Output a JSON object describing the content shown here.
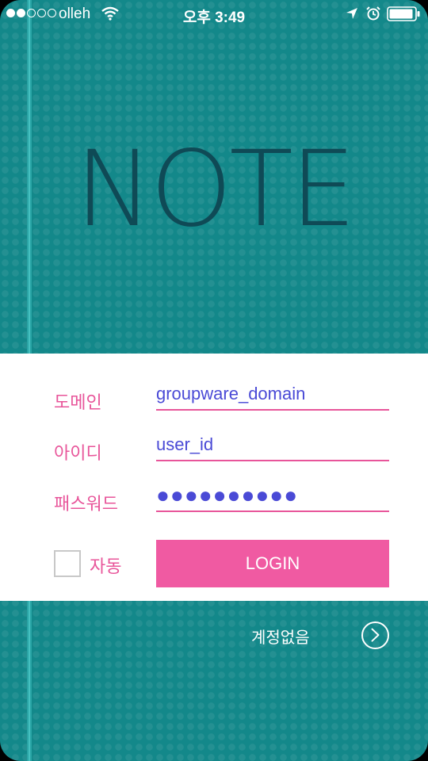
{
  "status_bar": {
    "carrier": "olleh",
    "time": "오후 3:49",
    "signal_bars_filled": 2,
    "signal_bars_total": 5
  },
  "app": {
    "title": "NOTE"
  },
  "login_form": {
    "domain_label": "도메인",
    "domain_value": "groupware_domain",
    "id_label": "아이디",
    "id_value": "user_id",
    "password_label": "패스워드",
    "password_value": "●●●●●●●●●●",
    "auto_login_label": "자동",
    "auto_login_checked": false,
    "login_button": "LOGIN"
  },
  "footer": {
    "no_account_label": "계정없음"
  },
  "colors": {
    "background_teal": "#13888a",
    "accent_pink": "#f05aa2",
    "label_pink": "#e8559a",
    "input_text_blue": "#4a4ad6",
    "title_dark": "#0f4a56"
  },
  "icons": [
    "wifi-icon",
    "location-icon",
    "alarm-icon",
    "battery-icon",
    "chevron-right-circle-icon"
  ]
}
